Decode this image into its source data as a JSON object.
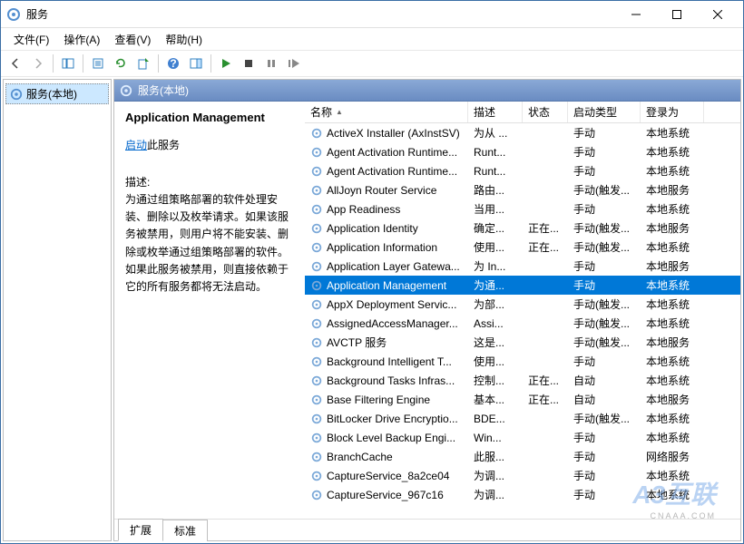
{
  "window": {
    "title": "服务"
  },
  "menu": {
    "file": "文件(F)",
    "action": "操作(A)",
    "view": "查看(V)",
    "help": "帮助(H)"
  },
  "tree": {
    "root": "服务(本地)"
  },
  "pane": {
    "title": "服务(本地)"
  },
  "detail": {
    "title": "Application Management",
    "start_link": "启动",
    "start_suffix": "此服务",
    "desc_label": "描述:",
    "desc": "为通过组策略部署的软件处理安装、删除以及枚举请求。如果该服务被禁用，则用户将不能安装、删除或枚举通过组策略部署的软件。如果此服务被禁用，则直接依赖于它的所有服务都将无法启动。"
  },
  "columns": {
    "name": "名称",
    "desc": "描述",
    "state": "状态",
    "start": "启动类型",
    "logon": "登录为"
  },
  "rows": [
    {
      "name": "ActiveX Installer (AxInstSV)",
      "desc": "为从 ...",
      "state": "",
      "start": "手动",
      "logon": "本地系统"
    },
    {
      "name": "Agent Activation Runtime...",
      "desc": "Runt...",
      "state": "",
      "start": "手动",
      "logon": "本地系统"
    },
    {
      "name": "Agent Activation Runtime...",
      "desc": "Runt...",
      "state": "",
      "start": "手动",
      "logon": "本地系统"
    },
    {
      "name": "AllJoyn Router Service",
      "desc": "路由...",
      "state": "",
      "start": "手动(触发...",
      "logon": "本地服务"
    },
    {
      "name": "App Readiness",
      "desc": "当用...",
      "state": "",
      "start": "手动",
      "logon": "本地系统"
    },
    {
      "name": "Application Identity",
      "desc": "确定...",
      "state": "正在...",
      "start": "手动(触发...",
      "logon": "本地服务"
    },
    {
      "name": "Application Information",
      "desc": "使用...",
      "state": "正在...",
      "start": "手动(触发...",
      "logon": "本地系统"
    },
    {
      "name": "Application Layer Gatewa...",
      "desc": "为 In...",
      "state": "",
      "start": "手动",
      "logon": "本地服务"
    },
    {
      "name": "Application Management",
      "desc": "为通...",
      "state": "",
      "start": "手动",
      "logon": "本地系统",
      "selected": true
    },
    {
      "name": "AppX Deployment Servic...",
      "desc": "为部...",
      "state": "",
      "start": "手动(触发...",
      "logon": "本地系统"
    },
    {
      "name": "AssignedAccessManager...",
      "desc": "Assi...",
      "state": "",
      "start": "手动(触发...",
      "logon": "本地系统"
    },
    {
      "name": "AVCTP 服务",
      "desc": "这是...",
      "state": "",
      "start": "手动(触发...",
      "logon": "本地服务"
    },
    {
      "name": "Background Intelligent T...",
      "desc": "使用...",
      "state": "",
      "start": "手动",
      "logon": "本地系统"
    },
    {
      "name": "Background Tasks Infras...",
      "desc": "控制...",
      "state": "正在...",
      "start": "自动",
      "logon": "本地系统"
    },
    {
      "name": "Base Filtering Engine",
      "desc": "基本...",
      "state": "正在...",
      "start": "自动",
      "logon": "本地服务"
    },
    {
      "name": "BitLocker Drive Encryptio...",
      "desc": "BDE...",
      "state": "",
      "start": "手动(触发...",
      "logon": "本地系统"
    },
    {
      "name": "Block Level Backup Engi...",
      "desc": "Win...",
      "state": "",
      "start": "手动",
      "logon": "本地系统"
    },
    {
      "name": "BranchCache",
      "desc": "此服...",
      "state": "",
      "start": "手动",
      "logon": "网络服务"
    },
    {
      "name": "CaptureService_8a2ce04",
      "desc": "为调...",
      "state": "",
      "start": "手动",
      "logon": "本地系统"
    },
    {
      "name": "CaptureService_967c16",
      "desc": "为调...",
      "state": "",
      "start": "手动",
      "logon": "本地系统"
    }
  ],
  "tabs": {
    "extended": "扩展",
    "standard": "标准"
  },
  "watermark": {
    "main": "A3互联",
    "sub": "CNAAA.COM"
  }
}
